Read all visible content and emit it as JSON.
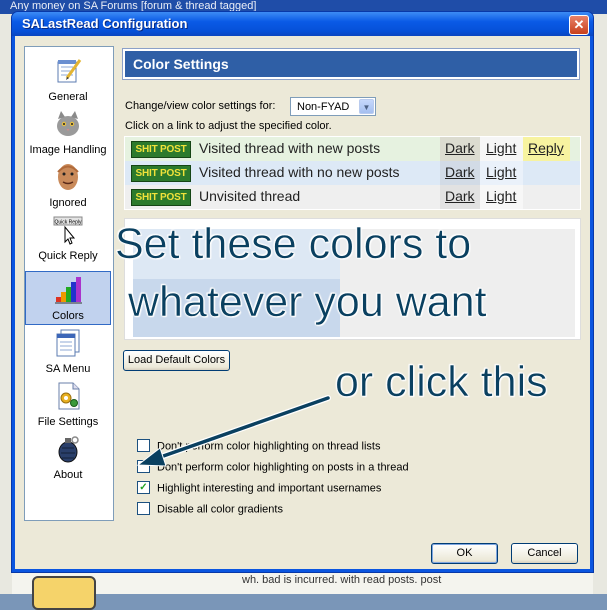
{
  "background": {
    "title_fragment": "Any money on SA Forums  [forum & thread tagged]",
    "footer_hint": "wh. bad is incurred. with read posts. post"
  },
  "window": {
    "title": "SALastRead Configuration",
    "close_glyph": "✕"
  },
  "sidebar": {
    "items": [
      {
        "label": "General",
        "icon": "notepad-pencil-icon"
      },
      {
        "label": "Image Handling",
        "icon": "cat-icon"
      },
      {
        "label": "Ignored",
        "icon": "face-icon"
      },
      {
        "label": "Quick Reply",
        "icon": "quick-reply-cursor-icon",
        "mini": "Quick Reply"
      },
      {
        "label": "Colors",
        "icon": "color-palette-icon",
        "active": true
      },
      {
        "label": "SA Menu",
        "icon": "menu-sheets-icon"
      },
      {
        "label": "File Settings",
        "icon": "file-settings-icon"
      },
      {
        "label": "About",
        "icon": "grenade-icon"
      }
    ]
  },
  "main": {
    "header": "Color Settings",
    "view_label": "Change/view color settings for:",
    "view_select": "Non-FYAD",
    "instruction": "Click on a link to adjust the specified color.",
    "rows": [
      {
        "badge": "SHIT POST",
        "name": "Visited thread with new posts",
        "dark": "Dark",
        "light": "Light",
        "reply": "Reply"
      },
      {
        "badge": "SHIT POST",
        "name": "Visited thread with no new posts",
        "dark": "Dark",
        "light": "Light",
        "reply": ""
      },
      {
        "badge": "SHIT POST",
        "name": "Unvisited thread",
        "dark": "Dark",
        "light": "Light",
        "reply": ""
      }
    ],
    "load_default": "Load Default Colors",
    "options": [
      {
        "label": "Don't perform color highlighting on thread lists",
        "checked": false
      },
      {
        "label": "Don't perform color highlighting on posts in a thread",
        "checked": false
      },
      {
        "label": "Highlight interesting and important usernames",
        "checked": true
      },
      {
        "label": "Disable all color gradients",
        "checked": false
      }
    ],
    "ok": "OK",
    "cancel": "Cancel"
  },
  "annotations": {
    "line1": "Set these colors to",
    "line2": "whatever you want",
    "line3": "or click this",
    "color": "#0a4060"
  }
}
